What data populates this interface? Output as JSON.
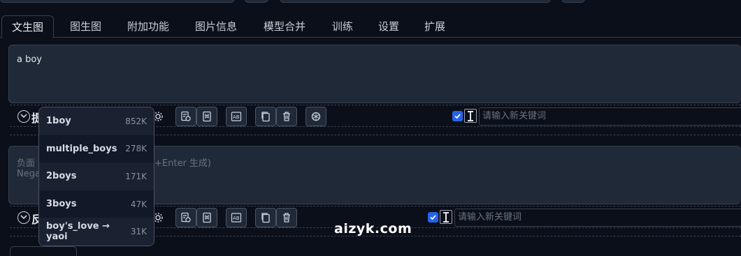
{
  "tabs": [
    {
      "label": "文生图",
      "active": true
    },
    {
      "label": "图生图"
    },
    {
      "label": "附加功能"
    },
    {
      "label": "图片信息"
    },
    {
      "label": "模型合并"
    },
    {
      "label": "训练"
    },
    {
      "label": "设置"
    },
    {
      "label": "扩展"
    }
  ],
  "positive": {
    "prompt_value": "a boy",
    "row_label": "提",
    "keyword_placeholder": "请输入新关键词",
    "checkbox_checked": true
  },
  "negative": {
    "placeholder_line1": "负面",
    "placeholder_line1_tail": "+Enter 生成)",
    "placeholder_line2": "Nega",
    "row_label": "反",
    "keyword_placeholder": "请输入新关键词",
    "checkbox_checked": true
  },
  "autocomplete": [
    {
      "name": "1boy",
      "count": "852K"
    },
    {
      "name": "multiple_boys",
      "count": "278K"
    },
    {
      "name": "2boys",
      "count": "171K"
    },
    {
      "name": "3boys",
      "count": "47K"
    },
    {
      "name": "boy's_love → yaoi",
      "count": "31K"
    }
  ],
  "watermark": "aizyk.com",
  "colors": {
    "accent": "#2563eb",
    "background": "#0b0f19",
    "panel": "#1f2937",
    "border": "#374151"
  }
}
